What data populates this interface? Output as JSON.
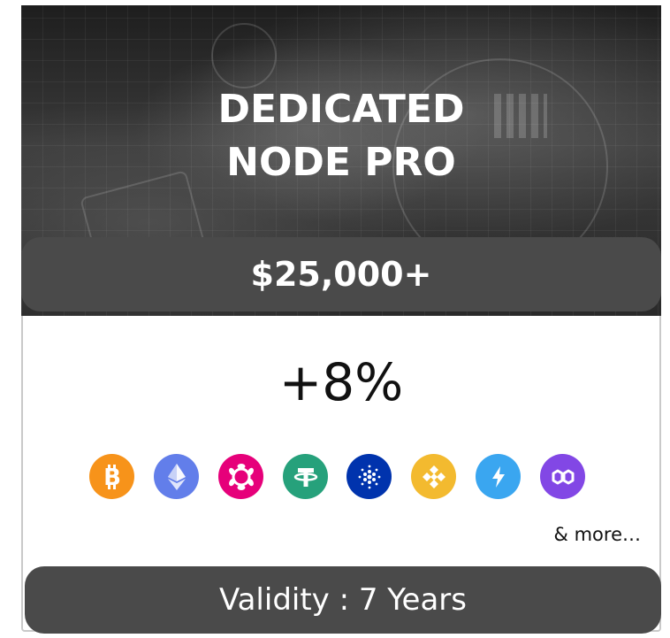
{
  "card": {
    "title_line1": "DEDICATED",
    "title_line2": "NODE PRO",
    "price": "$25,000+",
    "rate": "+8%",
    "more_text": "& more…",
    "validity": "Validity : 7 Years"
  },
  "coins": [
    {
      "icon": "bitcoin-icon",
      "color": "#F7931A"
    },
    {
      "icon": "ethereum-icon",
      "color": "#627EEA"
    },
    {
      "icon": "polkadot-icon",
      "color": "#E6007A"
    },
    {
      "icon": "tether-icon",
      "color": "#26A17B"
    },
    {
      "icon": "cardano-icon",
      "color": "#0033AD"
    },
    {
      "icon": "binance-icon",
      "color": "#F3BA2F"
    },
    {
      "icon": "lightning-icon",
      "color": "#3AA6F0"
    },
    {
      "icon": "polygon-icon",
      "color": "#8247E5"
    }
  ],
  "colors": {
    "pill_bg": "#4a4a4a",
    "hero_dark": "#2a2a2a",
    "text_white": "#ffffff"
  }
}
